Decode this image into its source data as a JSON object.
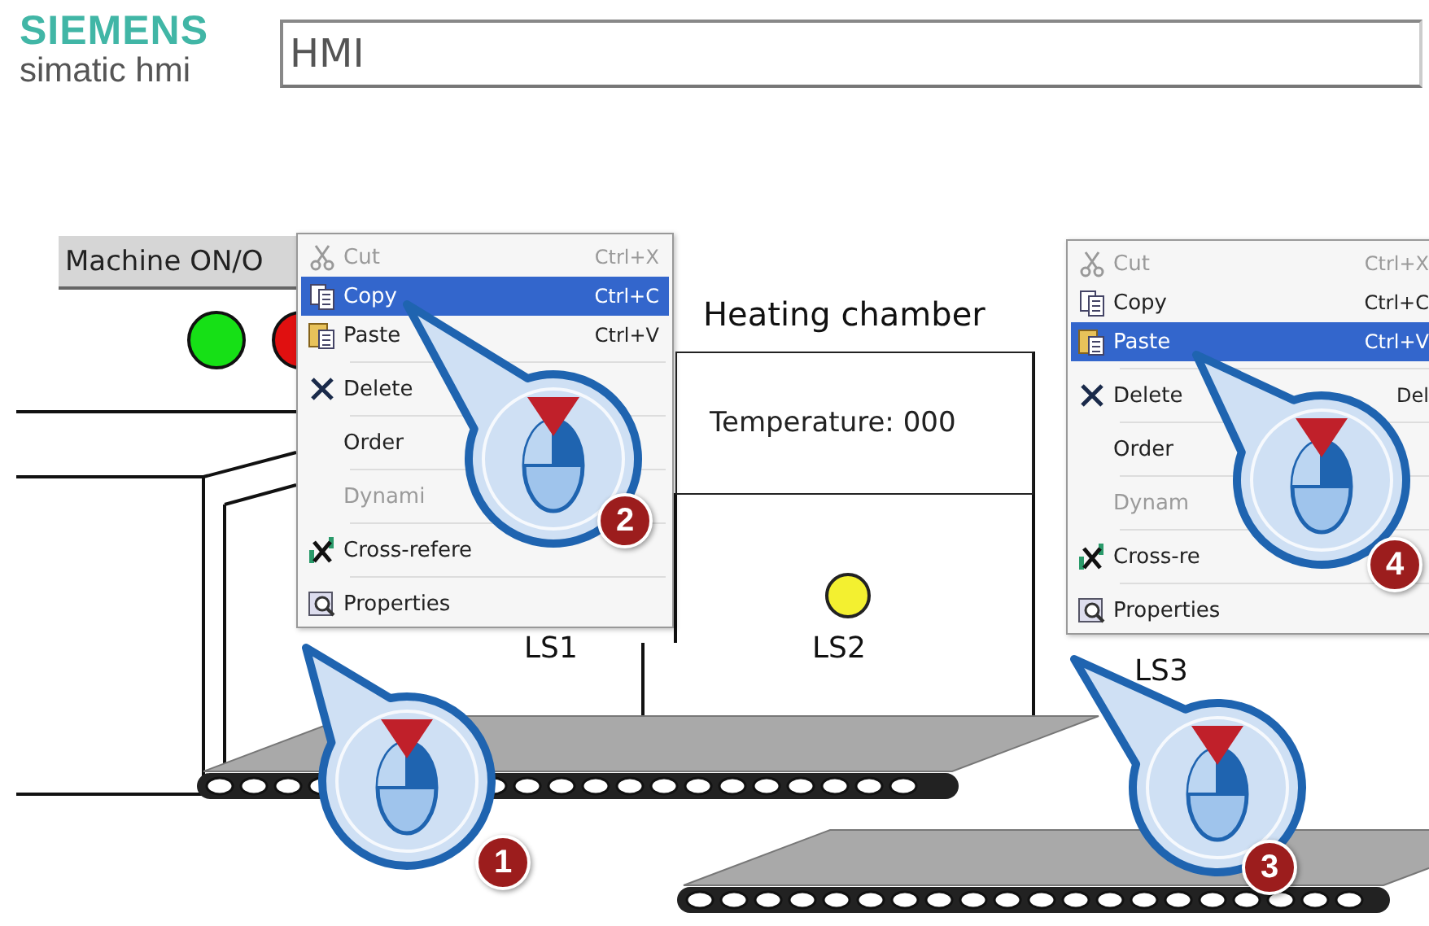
{
  "header": {
    "brand": "SIEMENS",
    "product": "simatic hmi",
    "title_field": "HMI"
  },
  "machine_button": {
    "label": "Machine ON/O"
  },
  "lamps": [
    {
      "color": "#16e016"
    },
    {
      "color": "#e01010"
    }
  ],
  "chamber": {
    "title": "Heating chamber",
    "reading": "Temperature: 000"
  },
  "sensors": [
    {
      "label": "LS1",
      "lamp": false
    },
    {
      "label": "LS2",
      "lamp": true
    },
    {
      "label": "LS3",
      "lamp": false
    }
  ],
  "context_menus": [
    {
      "items": [
        {
          "kind": "cut",
          "label": "Cut",
          "shortcut": "Ctrl+X",
          "disabled": true,
          "selected": false,
          "separator_above": false
        },
        {
          "kind": "copy",
          "label": "Copy",
          "shortcut": "Ctrl+C",
          "disabled": false,
          "selected": true,
          "separator_above": false
        },
        {
          "kind": "paste",
          "label": "Paste",
          "shortcut": "Ctrl+V",
          "disabled": false,
          "selected": false,
          "separator_above": false
        },
        {
          "kind": "delete",
          "label": "Delete",
          "disabled": false,
          "selected": false,
          "separator_above": true
        },
        {
          "kind": "plain",
          "label": "Order",
          "disabled": false,
          "selected": false,
          "separator_above": true
        },
        {
          "kind": "plain",
          "label": "Dynami",
          "disabled": true,
          "selected": false,
          "separator_above": true
        },
        {
          "kind": "crossref",
          "label": "Cross-refere",
          "disabled": false,
          "selected": false,
          "separator_above": true
        },
        {
          "kind": "properties",
          "label": "Properties",
          "disabled": false,
          "selected": false,
          "separator_above": true
        }
      ]
    },
    {
      "items": [
        {
          "kind": "cut",
          "label": "Cut",
          "shortcut": "Ctrl+X",
          "disabled": true,
          "selected": false,
          "separator_above": false
        },
        {
          "kind": "copy",
          "label": "Copy",
          "shortcut": "Ctrl+C",
          "disabled": false,
          "selected": false,
          "separator_above": false
        },
        {
          "kind": "paste",
          "label": "Paste",
          "shortcut": "Ctrl+V",
          "disabled": false,
          "selected": true,
          "separator_above": false
        },
        {
          "kind": "delete",
          "label": "Delete",
          "shortcut": "Del",
          "disabled": false,
          "selected": false,
          "separator_above": true
        },
        {
          "kind": "plain",
          "label": "Order",
          "disabled": false,
          "selected": false,
          "separator_above": true
        },
        {
          "kind": "plain",
          "label": "Dynam",
          "disabled": true,
          "selected": false,
          "separator_above": true
        },
        {
          "kind": "crossref",
          "label": "Cross-re",
          "disabled": false,
          "selected": false,
          "separator_above": true
        },
        {
          "kind": "properties",
          "label": "Properties",
          "disabled": false,
          "selected": false,
          "separator_above": true
        }
      ]
    }
  ],
  "callouts": [
    {
      "number": "1"
    },
    {
      "number": "2"
    },
    {
      "number": "3"
    },
    {
      "number": "4"
    }
  ]
}
